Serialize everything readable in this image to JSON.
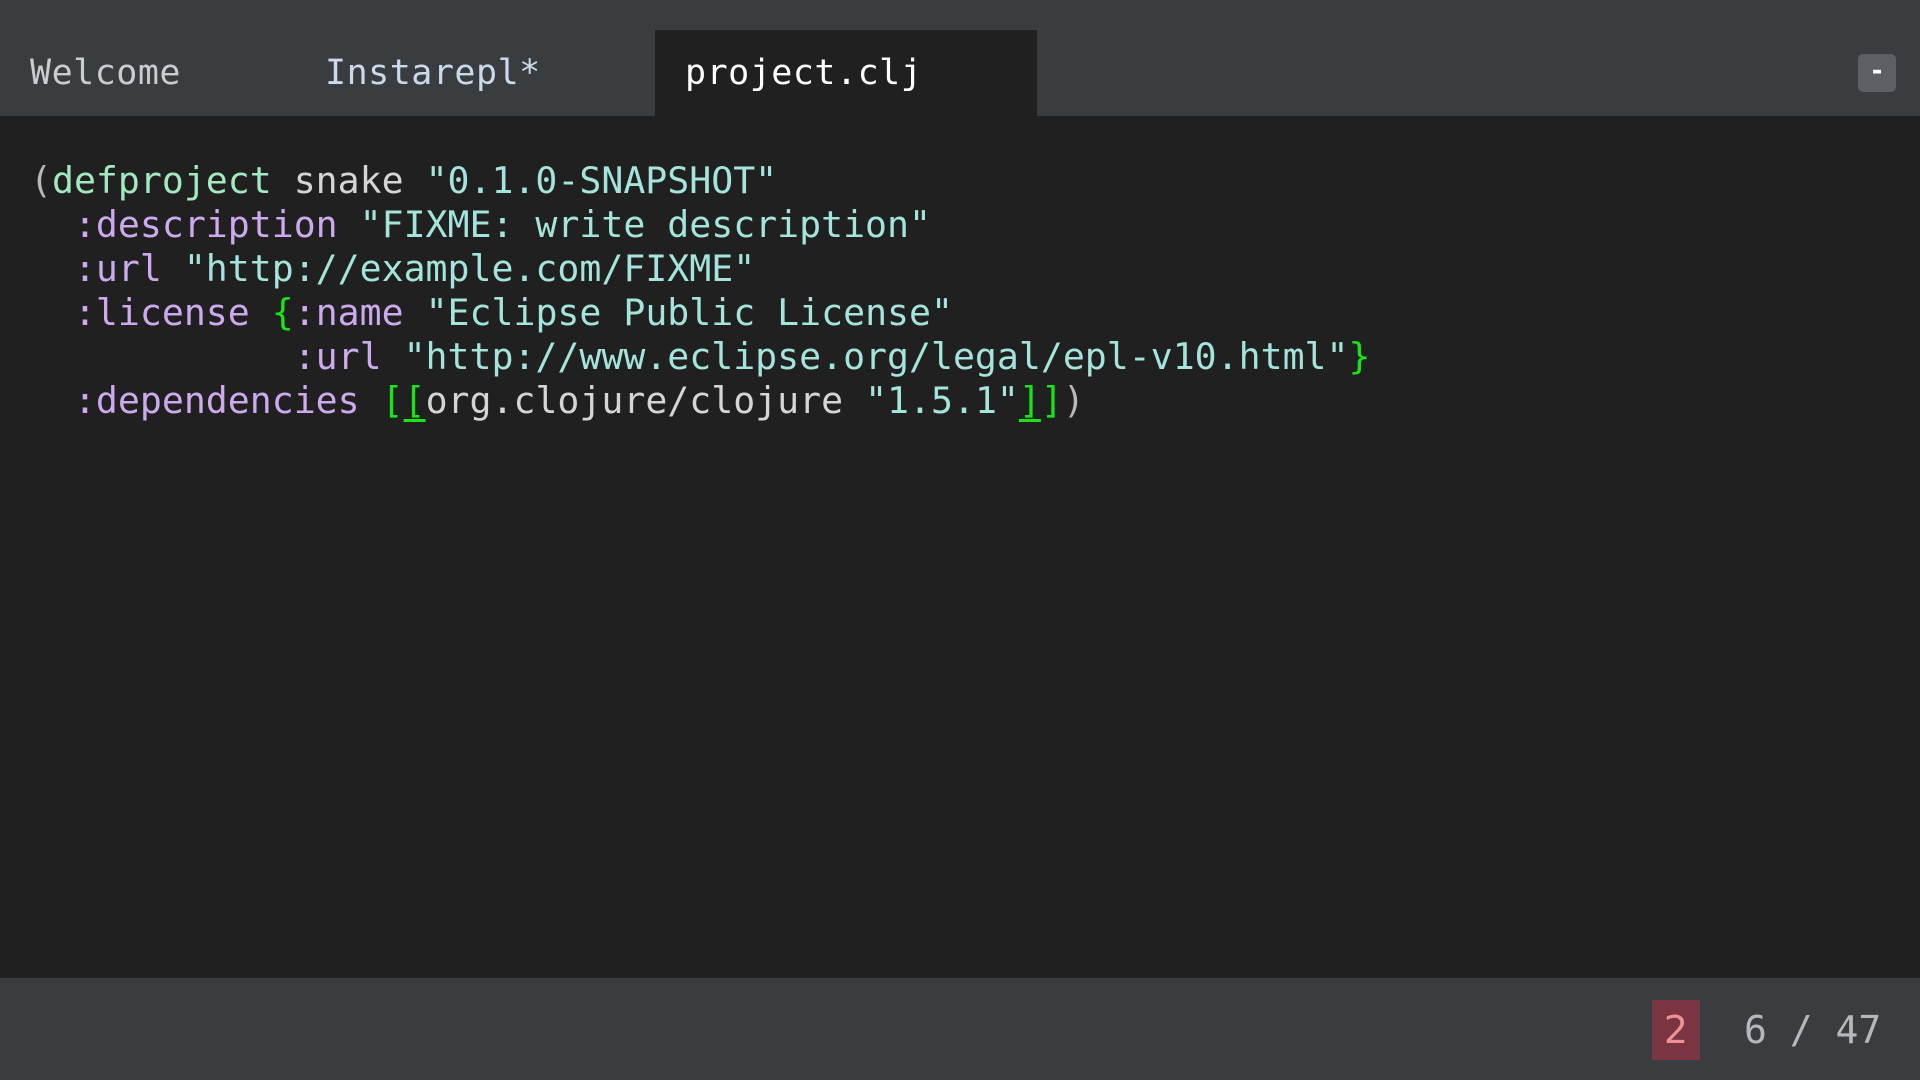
{
  "tabs": [
    {
      "label": "Welcome",
      "active": false
    },
    {
      "label": "Instarepl*",
      "active": false
    },
    {
      "label": "project.clj",
      "active": true
    }
  ],
  "tabbar": {
    "minimize_label": "-"
  },
  "editor": {
    "language": "clojure",
    "lines": [
      {
        "t1": "(",
        "t2": "defproject",
        "t3": " snake ",
        "t4": "\"0.1.0-SNAPSHOT\""
      },
      {
        "t1": "  :description",
        "t2": " \"FIXME: write description\""
      },
      {
        "t1": "  :url",
        "t2": " \"http://example.com/FIXME\""
      },
      {
        "t1": "  :license ",
        "t2": "{",
        "t3": ":name",
        "t4": " \"Eclipse Public License\""
      },
      {
        "t1": "            :url",
        "t2": " \"http://www.eclipse.org/legal/epl-v10.html\"",
        "t3": "}"
      },
      {
        "t1": "  :dependencies ",
        "t2": "[",
        "t3": "[",
        "t4": "org.clojure/clojure ",
        "t5": "\"1.5.1\"",
        "t6": "]",
        "t7": "]",
        "t8": ")"
      }
    ]
  },
  "statusbar": {
    "error_count": "2",
    "position": "6 / 47"
  },
  "colors": {
    "tabbar_bg": "#393d40",
    "editor_bg": "#202020",
    "keyword": "#a3e9c0",
    "string": "#a4e4dc",
    "clojure_keyword": "#cda9ee",
    "brace_match": "#18e418",
    "error_badge_bg": "#7a3540",
    "error_badge_text": "#ef8f96"
  }
}
